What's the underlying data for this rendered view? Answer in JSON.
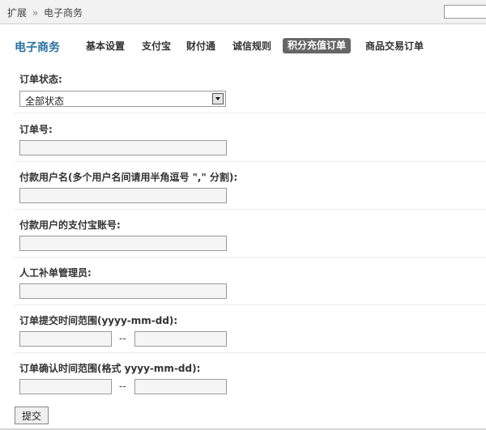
{
  "breadcrumb": {
    "parent": "扩展",
    "separator": "»",
    "current": "电子商务"
  },
  "nav": {
    "title": "电子商务",
    "tabs": [
      {
        "label": "基本设置",
        "active": false
      },
      {
        "label": "支付宝",
        "active": false
      },
      {
        "label": "财付通",
        "active": false
      },
      {
        "label": "诚信规则",
        "active": false
      },
      {
        "label": "积分充值订单",
        "active": true
      },
      {
        "label": "商品交易订单",
        "active": false
      }
    ]
  },
  "form": {
    "order_status": {
      "label": "订单状态:",
      "selected": "全部状态"
    },
    "order_no": {
      "label": "订单号:",
      "value": ""
    },
    "payer_username": {
      "label": "付款用户名(多个用户名间请用半角逗号 \",\" 分割):",
      "value": ""
    },
    "payer_alipay": {
      "label": "付款用户的支付宝账号:",
      "value": ""
    },
    "manual_admin": {
      "label": "人工补单管理员:",
      "value": ""
    },
    "submit_range": {
      "label": "订单提交时间范围(yyyy-mm-dd):",
      "separator": "--",
      "from": "",
      "to": ""
    },
    "confirm_range": {
      "label": "订单确认时间范围(格式 yyyy-mm-dd):",
      "separator": "--",
      "from": "",
      "to": ""
    },
    "submit_label": "提交"
  }
}
